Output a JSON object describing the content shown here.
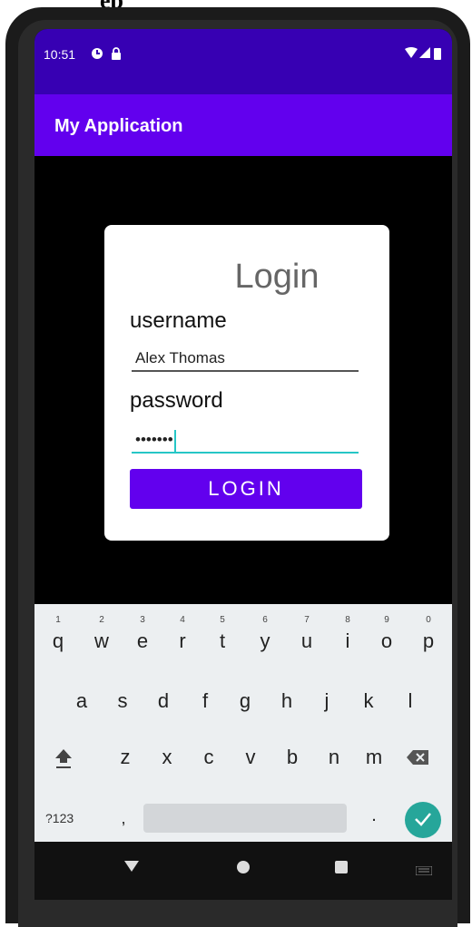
{
  "status_bar": {
    "time": "10:51"
  },
  "app_bar": {
    "title": "My Application"
  },
  "login": {
    "title": "Login",
    "username_label": "username",
    "username_value": "Alex Thomas",
    "password_label": "password",
    "password_value": "•••••••",
    "button_label": "LOGIN"
  },
  "keyboard": {
    "row1": [
      {
        "key": "q",
        "hint": "1"
      },
      {
        "key": "w",
        "hint": "2"
      },
      {
        "key": "e",
        "hint": "3"
      },
      {
        "key": "r",
        "hint": "4"
      },
      {
        "key": "t",
        "hint": "5"
      },
      {
        "key": "y",
        "hint": "6"
      },
      {
        "key": "u",
        "hint": "7"
      },
      {
        "key": "i",
        "hint": "8"
      },
      {
        "key": "o",
        "hint": "9"
      },
      {
        "key": "p",
        "hint": "0"
      }
    ],
    "row2": [
      "a",
      "s",
      "d",
      "f",
      "g",
      "h",
      "j",
      "k",
      "l"
    ],
    "row3": [
      "z",
      "x",
      "c",
      "v",
      "b",
      "n",
      "m"
    ],
    "symbols_label": "?123",
    "comma": ",",
    "period": "."
  },
  "colors": {
    "status_bar": "#3700b3",
    "app_bar": "#6200ee",
    "button": "#6200ee",
    "focus_accent": "#26c6c6",
    "enter_key": "#26a69a"
  }
}
